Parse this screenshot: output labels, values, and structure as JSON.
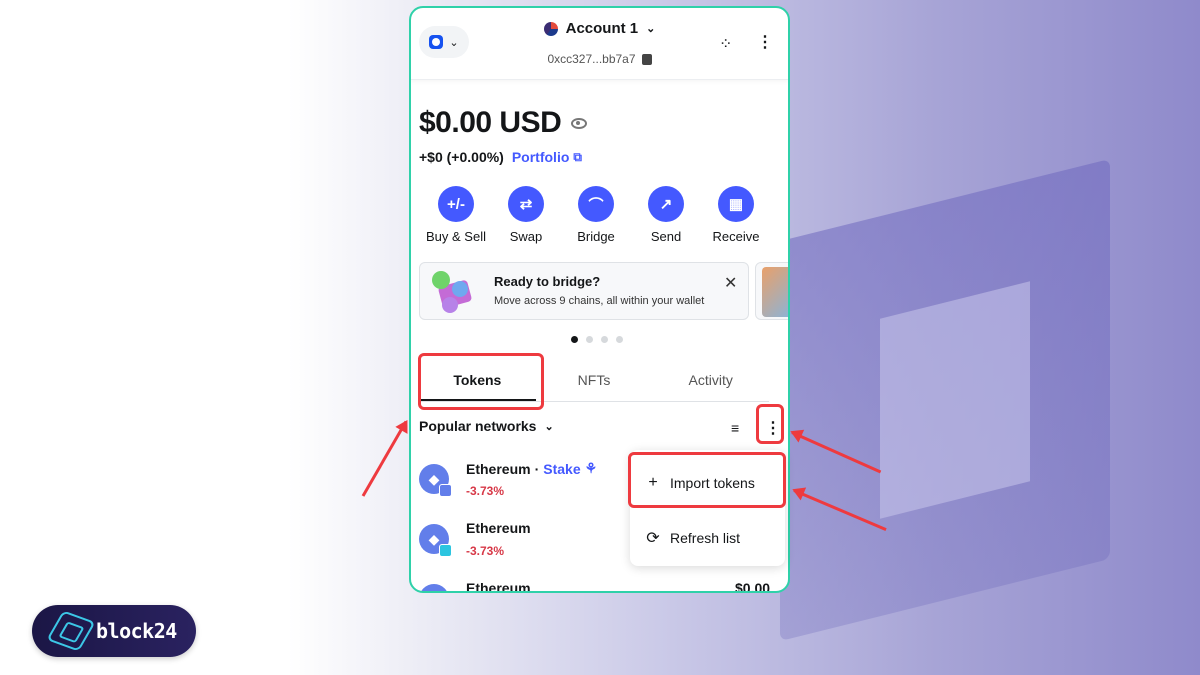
{
  "header": {
    "account_name": "Account 1",
    "address": "0xcc327...bb7a7",
    "network_icon": "network-logo-icon",
    "menu_icon": "kebab-menu-icon"
  },
  "balance": {
    "amount": "$0.00 USD",
    "change": "+$0 (+0.00%)",
    "portfolio_label": "Portfolio"
  },
  "actions": [
    {
      "label": "Buy & Sell",
      "icon": "+/-"
    },
    {
      "label": "Swap",
      "icon": "⇄"
    },
    {
      "label": "Bridge",
      "icon": "⌒"
    },
    {
      "label": "Send",
      "icon": "↗"
    },
    {
      "label": "Receive",
      "icon": "▦"
    }
  ],
  "banner": {
    "title": "Ready to bridge?",
    "subtitle": "Move across 9 chains, all within your wallet",
    "close": "✕"
  },
  "carousel": {
    "count": 4,
    "active": 0
  },
  "tabs": [
    {
      "label": "Tokens",
      "active": true
    },
    {
      "label": "NFTs",
      "active": false
    },
    {
      "label": "Activity",
      "active": false
    }
  ],
  "filter": {
    "label": "Popular networks"
  },
  "tokens": [
    {
      "name": "Ethereum",
      "stake": "Stake",
      "change": "-3.73%",
      "value": ""
    },
    {
      "name": "Ethereum",
      "stake": "",
      "change": "-3.73%",
      "value": ""
    },
    {
      "name": "Ethereum",
      "stake": "",
      "change": "",
      "value": "$0.00"
    }
  ],
  "menu": {
    "import_label": "Import tokens",
    "refresh_label": "Refresh list"
  },
  "logo": {
    "text": "block24"
  },
  "colors": {
    "accent": "#4459ff",
    "negative": "#d73847",
    "highlight": "#ee3a3f",
    "frame": "#2fd1a9"
  }
}
